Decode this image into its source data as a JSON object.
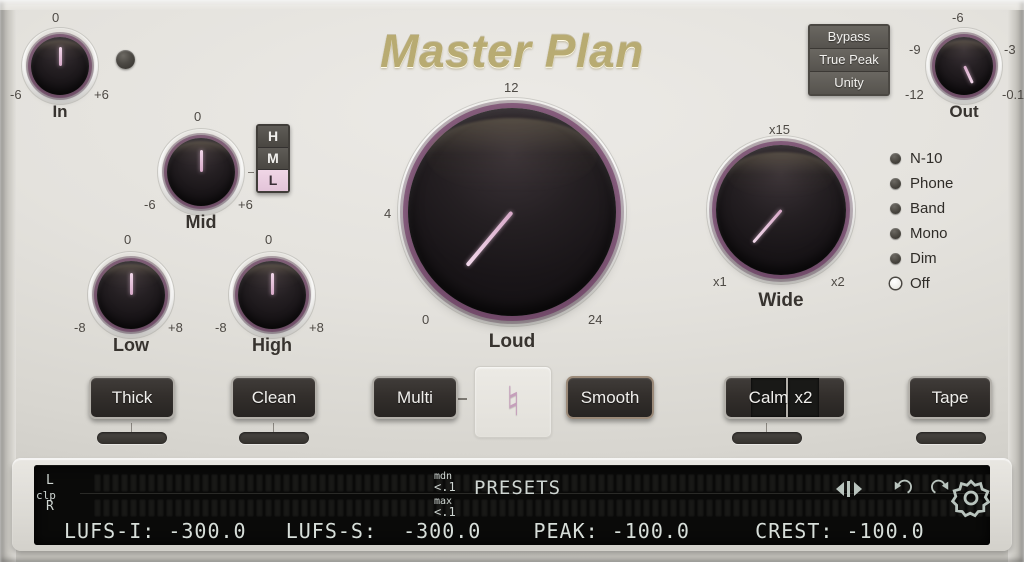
{
  "plugin": {
    "title": "Master Plan",
    "brand_color": "#b8ab72",
    "accent_color": "#d7a9c8",
    "panel_color": "#e4e2dd"
  },
  "top_buttons": [
    {
      "label": "Bypass",
      "active": false
    },
    {
      "label": "True Peak",
      "active": false
    },
    {
      "label": "Unity",
      "active": false
    }
  ],
  "knobs": {
    "in": {
      "label": "In",
      "min_tick": "-6",
      "max_tick": "+6",
      "top_tick": "0",
      "value_deg": 0
    },
    "out": {
      "label": "Out",
      "min_tick": "-12",
      "max_tick": "-0.1",
      "top_tick": "-6",
      "left_mid": "-9",
      "right_mid": "-3",
      "value_deg": 32
    },
    "mid": {
      "label": "Mid",
      "min_tick": "-6",
      "max_tick": "+6",
      "top_tick": "0",
      "value_deg": 0
    },
    "low": {
      "label": "Low",
      "min_tick": "-8",
      "max_tick": "+8",
      "top_tick": "0",
      "value_deg": 0
    },
    "high": {
      "label": "High",
      "min_tick": "-8",
      "max_tick": "+8",
      "top_tick": "0",
      "value_deg": 0
    },
    "loud": {
      "label": "Loud",
      "min_tick": "0",
      "max_tick": "24",
      "top_tick": "12",
      "left_mid": "4",
      "value_deg": -43
    },
    "wide": {
      "label": "Wide",
      "min_tick": "x1",
      "max_tick": "x2",
      "top_tick": "x15",
      "value_deg": -52
    }
  },
  "band_selector": {
    "name": "hml",
    "options": [
      "H",
      "M",
      "L"
    ],
    "selected": "L"
  },
  "monitor_modes": [
    {
      "label": "N-10",
      "selected": false
    },
    {
      "label": "Phone",
      "selected": false
    },
    {
      "label": "Band",
      "selected": false
    },
    {
      "label": "Mono",
      "selected": false
    },
    {
      "label": "Dim",
      "selected": false
    },
    {
      "label": "Off",
      "selected": true
    }
  ],
  "main_buttons": {
    "thick": "Thick",
    "clean": "Clean",
    "multi": "Multi",
    "smooth": "Smooth",
    "calm": "Calm",
    "calm_x2": "x2",
    "tape": "Tape"
  },
  "logo_glyph": "♮",
  "display": {
    "meter_left_label": "L",
    "meter_right_label": "R",
    "clip_label": "clp",
    "mdn_label": "mdn",
    "mdn_value": "<.1",
    "max_label": "max",
    "max_value": "<.1",
    "presets_label": "PRESETS",
    "status": "LUFS-I: -300.0   LUFS-S:  -300.0    PEAK: -100.0     CREST: -100.0",
    "readouts": [
      {
        "name": "LUFS-I",
        "value": "-300.0"
      },
      {
        "name": "LUFS-S",
        "value": "-300.0"
      },
      {
        "name": "PEAK",
        "value": "-100.0"
      },
      {
        "name": "CREST",
        "value": "-100.0"
      }
    ],
    "icons": [
      "preset-prev-next-icon",
      "undo-icon",
      "redo-icon",
      "gear-icon"
    ]
  }
}
